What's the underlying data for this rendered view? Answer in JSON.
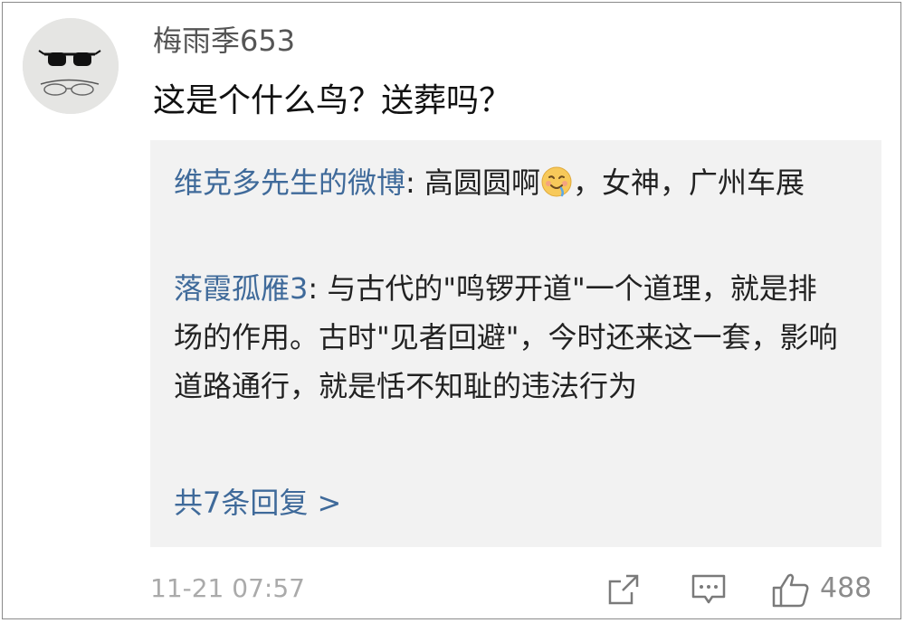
{
  "comment": {
    "username": "梅雨季653",
    "text": "这是个什么鸟？送葬吗？",
    "timestamp": "11-21 07:57",
    "like_count": "488"
  },
  "replies": [
    {
      "author": "维克多先生的微博",
      "separator": ": ",
      "text_before_emoji": "高圆圆啊",
      "emoji": "drooling-face-emoji",
      "text_after_emoji": "，女神，广州车展"
    },
    {
      "author": "落霞孤雁3",
      "separator": ": ",
      "text": "与古代的\"鸣锣开道\"一个道理，就是排场的作用。古时\"见者回避\"，今时还来这一套，影响道路通行，就是恬不知耻的违法行为"
    }
  ],
  "more_replies_label": "共7条回复 >",
  "icons": {
    "avatar": "sunglasses-avatar",
    "share": "share-icon",
    "reply": "comment-icon",
    "like": "thumbs-up-icon"
  },
  "colors": {
    "link": "#3f6a9a",
    "reply_box_bg": "#f2f2f2",
    "muted": "#aaaaaa"
  }
}
